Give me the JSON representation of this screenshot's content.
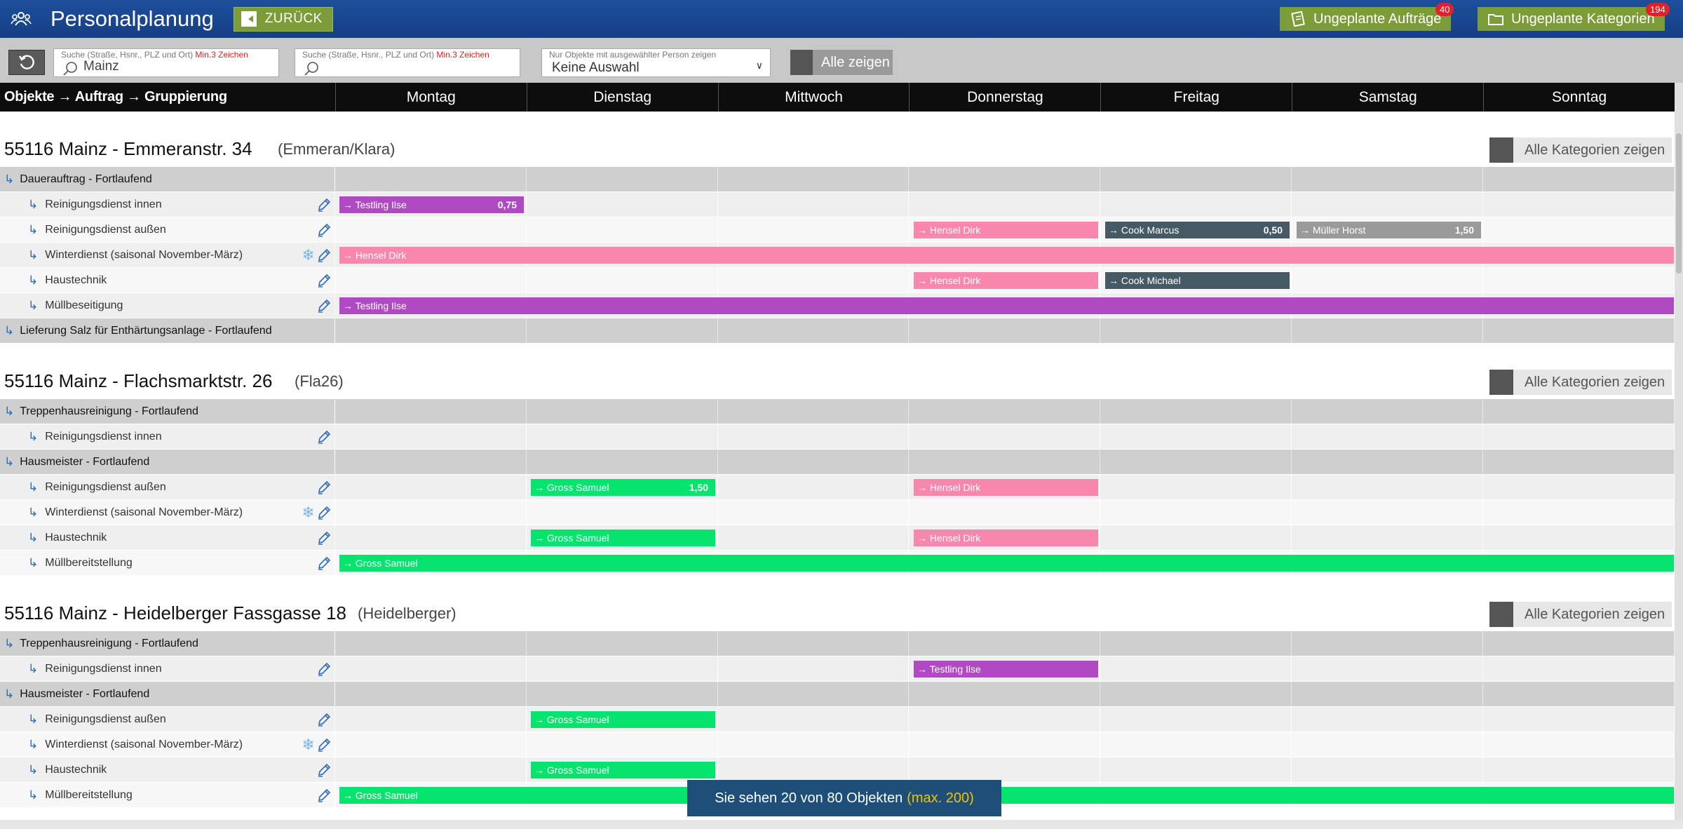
{
  "app": {
    "title": "Personalplanung",
    "back_label": "ZURÜCK",
    "unplanned_orders_label": "Ungeplante Aufträge",
    "unplanned_orders_count": "40",
    "unplanned_categories_label": "Ungeplante Kategorien",
    "unplanned_categories_count": "194"
  },
  "filters": {
    "search_hint": "Suche (Straße, Hsnr., PLZ und Ort)",
    "search_hint_min": "Min.3 Zeichen",
    "search1_value": "Mainz",
    "search2_value": "",
    "person_hint": "Nur Objekte mit ausgewählter Person zeigen",
    "person_value": "Keine Auswahl",
    "show_all_label": "Alle zeigen"
  },
  "header": {
    "first_col": "Objekte → Auftrag → Gruppierung",
    "days": [
      "Montag",
      "Dienstag",
      "Mittwoch",
      "Donnerstag",
      "Freitag",
      "Samstag",
      "Sonntag"
    ]
  },
  "show_categories_label": "Alle Kategorien zeigen",
  "colors": {
    "purple": "#b04ac3",
    "pink": "#f987ad",
    "dark": "#465a66",
    "grey": "#9a9a9a",
    "green": "#06e36e"
  },
  "objects": [
    {
      "title": "55116 Mainz - Emmeranstr. 34",
      "short": "(Emmeran/Klara)",
      "rows": [
        {
          "type": "group",
          "label": "Dauerauftrag - Fortlaufend"
        },
        {
          "type": "cat",
          "label": "Reinigungsdienst innen",
          "bars": [
            {
              "start": 0,
              "span": 1,
              "text": "→ Testling Ilse",
              "num": "0,75",
              "color": "purple"
            }
          ]
        },
        {
          "type": "cat",
          "label": "Reinigungsdienst außen",
          "bars": [
            {
              "start": 3,
              "span": 1,
              "text": "→ Hensel Dirk",
              "num": "",
              "color": "pink"
            },
            {
              "start": 4,
              "span": 1,
              "text": "→ Cook Marcus",
              "num": "0,50",
              "color": "dark"
            },
            {
              "start": 5,
              "span": 1,
              "text": "→ Müller Horst",
              "num": "1,50",
              "color": "grey"
            }
          ]
        },
        {
          "type": "cat",
          "label": "Winterdienst (saisonal November-März)",
          "snow": true,
          "bars": [
            {
              "start": 0,
              "span": 7,
              "text": "→ Hensel Dirk",
              "num": "",
              "color": "pink"
            }
          ]
        },
        {
          "type": "cat",
          "label": "Haustechnik",
          "bars": [
            {
              "start": 3,
              "span": 1,
              "text": "→ Hensel Dirk",
              "num": "",
              "color": "pink"
            },
            {
              "start": 4,
              "span": 1,
              "text": "→ Cook Michael",
              "num": "",
              "color": "dark"
            }
          ]
        },
        {
          "type": "cat",
          "label": "Müllbeseitigung",
          "bars": [
            {
              "start": 0,
              "span": 7,
              "text": "→ Testling Ilse",
              "num": "",
              "color": "purple"
            }
          ]
        },
        {
          "type": "group",
          "label": "Lieferung Salz für Enthärtungsanlage - Fortlaufend",
          "tight": true
        }
      ]
    },
    {
      "title": "55116 Mainz - Flachsmarktstr. 26",
      "short": "(Fla26)",
      "rows": [
        {
          "type": "group",
          "label": "Treppenhausreinigung - Fortlaufend"
        },
        {
          "type": "cat",
          "label": "Reinigungsdienst innen",
          "bars": []
        },
        {
          "type": "group",
          "label": "Hausmeister - Fortlaufend"
        },
        {
          "type": "cat",
          "label": "Reinigungsdienst außen",
          "bars": [
            {
              "start": 1,
              "span": 1,
              "text": "→ Gross Samuel",
              "num": "1,50",
              "color": "green"
            },
            {
              "start": 3,
              "span": 1,
              "text": "→ Hensel Dirk",
              "num": "",
              "color": "pink"
            }
          ]
        },
        {
          "type": "cat",
          "label": "Winterdienst (saisonal November-März)",
          "snow": true,
          "bars": []
        },
        {
          "type": "cat",
          "label": "Haustechnik",
          "bars": [
            {
              "start": 1,
              "span": 1,
              "text": "→ Gross Samuel",
              "num": "",
              "color": "green"
            },
            {
              "start": 3,
              "span": 1,
              "text": "→ Hensel Dirk",
              "num": "",
              "color": "pink"
            }
          ]
        },
        {
          "type": "cat",
          "label": "Müllbereitstellung",
          "bars": [
            {
              "start": 0,
              "span": 7,
              "text": "→ Gross Samuel",
              "num": "",
              "color": "green"
            }
          ]
        }
      ]
    },
    {
      "title": "55116 Mainz - Heidelberger Fassgasse 18",
      "short": "(Heidelberger)",
      "rows": [
        {
          "type": "group",
          "label": "Treppenhausreinigung - Fortlaufend"
        },
        {
          "type": "cat",
          "label": "Reinigungsdienst innen",
          "bars": [
            {
              "start": 3,
              "span": 1,
              "text": "→ Testling Ilse",
              "num": "",
              "color": "purple"
            }
          ]
        },
        {
          "type": "group",
          "label": "Hausmeister - Fortlaufend"
        },
        {
          "type": "cat",
          "label": "Reinigungsdienst außen",
          "bars": [
            {
              "start": 1,
              "span": 1,
              "text": "→ Gross Samuel",
              "num": "",
              "color": "green"
            }
          ]
        },
        {
          "type": "cat",
          "label": "Winterdienst (saisonal November-März)",
          "snow": true,
          "bars": []
        },
        {
          "type": "cat",
          "label": "Haustechnik",
          "bars": [
            {
              "start": 1,
              "span": 1,
              "text": "→ Gross Samuel",
              "num": "",
              "color": "green"
            }
          ]
        },
        {
          "type": "cat",
          "label": "Müllbereitstellung",
          "bars": [
            {
              "start": 0,
              "span": 7,
              "text": "→ Gross Samuel",
              "num": "",
              "color": "green"
            }
          ]
        }
      ]
    }
  ],
  "footer": {
    "visible_text": "Sie sehen 20 von 80 Objekten",
    "max_text": "(max. 200)"
  }
}
